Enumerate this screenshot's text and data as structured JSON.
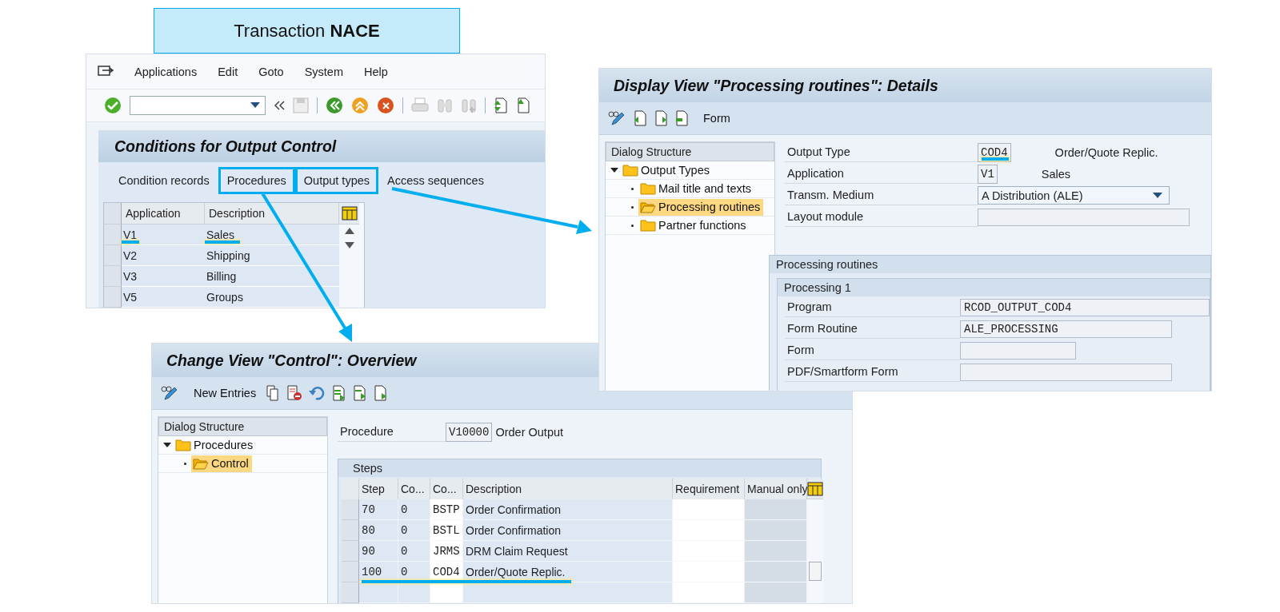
{
  "callout": {
    "text": "Transaction **NACE**"
  },
  "nace_window": {
    "menu": [
      "Applications",
      "Edit",
      "Goto",
      "System",
      "Help"
    ],
    "title": "Conditions for Output Control",
    "tabs": [
      {
        "label": "Condition records",
        "highlighted": false
      },
      {
        "label": "Procedures",
        "highlighted": true
      },
      {
        "label": "Output types",
        "highlighted": true
      },
      {
        "label": "Access sequences",
        "highlighted": false
      }
    ],
    "table": {
      "columns": [
        "Application",
        "Description"
      ],
      "rows": [
        {
          "cells": [
            "V1",
            "Sales"
          ],
          "marked": true
        },
        {
          "cells": [
            "V2",
            "Shipping"
          ],
          "marked": false
        },
        {
          "cells": [
            "V3",
            "Billing"
          ],
          "marked": false
        },
        {
          "cells": [
            "V5",
            "Groups"
          ],
          "marked": false
        }
      ]
    }
  },
  "details_window": {
    "title": "Display View \"Processing routines\": Details",
    "toolbar_label": "Form",
    "tree": {
      "header": "Dialog Structure",
      "items": [
        {
          "label": "Output Types",
          "selected": false,
          "expanded": true,
          "children": [
            {
              "label": "Mail title and texts",
              "selected": false
            },
            {
              "label": "Processing routines",
              "selected": true
            },
            {
              "label": "Partner functions",
              "selected": false
            }
          ]
        }
      ]
    },
    "fields": [
      {
        "kind": "code",
        "label": "Output Type",
        "value": "COD4",
        "description": "Order/Quote Replic.",
        "marked": true
      },
      {
        "kind": "code",
        "label": "Application",
        "value": "V1",
        "description": "Sales",
        "marked": false
      },
      {
        "kind": "dropdown",
        "label": "Transm. Medium",
        "value": "A Distribution (ALE)"
      },
      {
        "kind": "input",
        "label": "Layout module"
      }
    ],
    "group": {
      "title": "Processing routines",
      "subgroup": {
        "title": "Processing 1",
        "fields": [
          {
            "label": "Program",
            "value": "RCOD_OUTPUT_COD4"
          },
          {
            "label": "Form Routine",
            "value": "ALE_PROCESSING"
          },
          {
            "label": "Form"
          },
          {
            "label": "PDF/Smartform Form"
          }
        ]
      }
    }
  },
  "control_window": {
    "title": "Change View \"Control\": Overview",
    "toolbar_label": "New Entries",
    "tree": {
      "header": "Dialog Structure",
      "items": [
        {
          "label": "Procedures",
          "selected": false,
          "expanded": true,
          "children": [
            {
              "label": "Control",
              "selected": true
            }
          ]
        }
      ]
    },
    "procedure": {
      "label": "Procedure",
      "value": "V10000",
      "description": "Order Output"
    },
    "steps": {
      "title": "Steps",
      "columns": [
        "Step",
        "Co...",
        "Co...",
        "Description",
        "Requirement",
        "Manual only"
      ],
      "rows": [
        {
          "cells": [
            "70",
            "0",
            "BSTP",
            "Order Confirmation"
          ],
          "marked": false
        },
        {
          "cells": [
            "80",
            "0",
            "BSTL",
            "Order Confirmation"
          ],
          "marked": false
        },
        {
          "cells": [
            "90",
            "0",
            "JRMS",
            "DRM Claim Request"
          ],
          "marked": false
        },
        {
          "cells": [
            "100",
            "0",
            "COD4",
            "Order/Quote Replic."
          ],
          "marked": true
        }
      ]
    }
  }
}
